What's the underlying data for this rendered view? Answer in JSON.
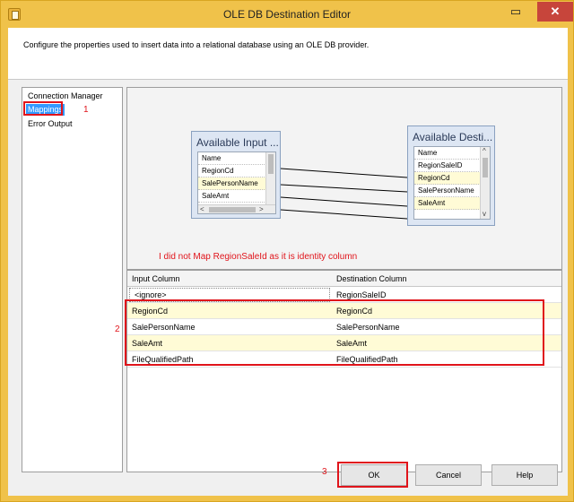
{
  "window": {
    "title": "OLE DB Destination Editor",
    "close_glyph": "✕",
    "minimize_glyph": "▭"
  },
  "description": "Configure the properties used to insert data into a relational database using an OLE DB provider.",
  "nav": {
    "items": [
      {
        "label": "Connection Manager",
        "selected": false
      },
      {
        "label": "Mappings",
        "selected": true
      },
      {
        "label": "Error Output",
        "selected": false
      }
    ]
  },
  "annotations": {
    "one": "1",
    "two": "2",
    "three": "3",
    "note": "I did not Map RegionSaleId as it is identity column",
    "color": "#e0141b"
  },
  "input_table": {
    "title": "Available Input ...",
    "rows": [
      "Name",
      "RegionCd",
      "SalePersonName",
      "SaleAmt"
    ]
  },
  "destination_table": {
    "title": "Available Desti...",
    "rows": [
      "Name",
      "RegionSaleID",
      "RegionCd",
      "SalePersonName",
      "SaleAmt"
    ]
  },
  "mapping_grid": {
    "headers": [
      "Input Column",
      "Destination Column"
    ],
    "rows": [
      {
        "input": "<ignore>",
        "destination": "RegionSaleID"
      },
      {
        "input": "RegionCd",
        "destination": "RegionCd"
      },
      {
        "input": "SalePersonName",
        "destination": "SalePersonName"
      },
      {
        "input": "SaleAmt",
        "destination": "SaleAmt"
      },
      {
        "input": "FileQualifiedPath",
        "destination": "FileQualifiedPath"
      }
    ]
  },
  "buttons": {
    "ok": "OK",
    "cancel": "Cancel",
    "help": "Help"
  },
  "scroll_glyphs": {
    "up": "^",
    "down": "v",
    "left": "<",
    "right": ">"
  }
}
